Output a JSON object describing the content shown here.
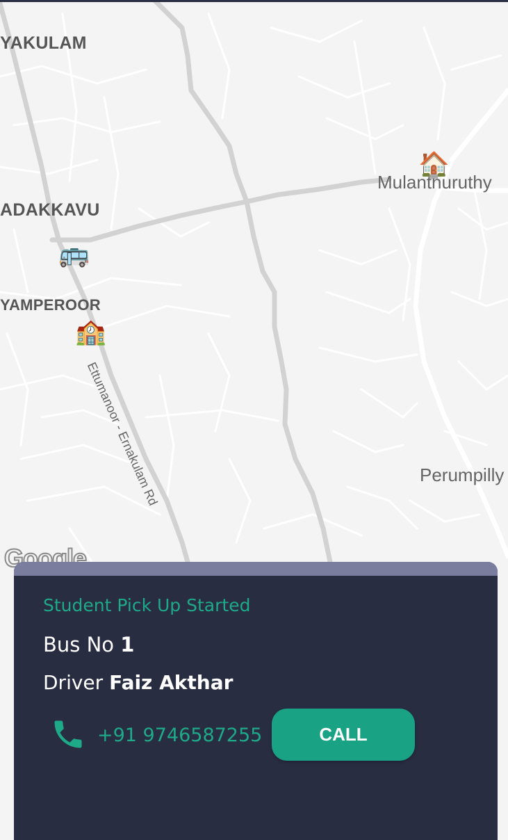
{
  "map": {
    "places": {
      "ayakulam": "YAKULAM",
      "edakkavu": "ADAKKAVU",
      "yamperoor": "YAMPEROOR",
      "mulanthuruthy": "Mulanthuruthy",
      "perumpilly": "Perumpilly"
    },
    "road_label": "Ettumanoor - Ernakulam Rd",
    "attribution": "Google",
    "markers": {
      "bus": "🚌",
      "school": "🏫",
      "home": "🏠"
    }
  },
  "trip": {
    "status": "Student Pick Up Started",
    "bus_prefix": "Bus No",
    "bus_number": "1",
    "driver_prefix": "Driver",
    "driver_name": "Faiz Akthar",
    "phone": "+91 9746587255",
    "call_label": "CALL"
  },
  "colors": {
    "accent": "#19a384",
    "panel": "#292d42",
    "panel_header": "#7a7d9e"
  }
}
